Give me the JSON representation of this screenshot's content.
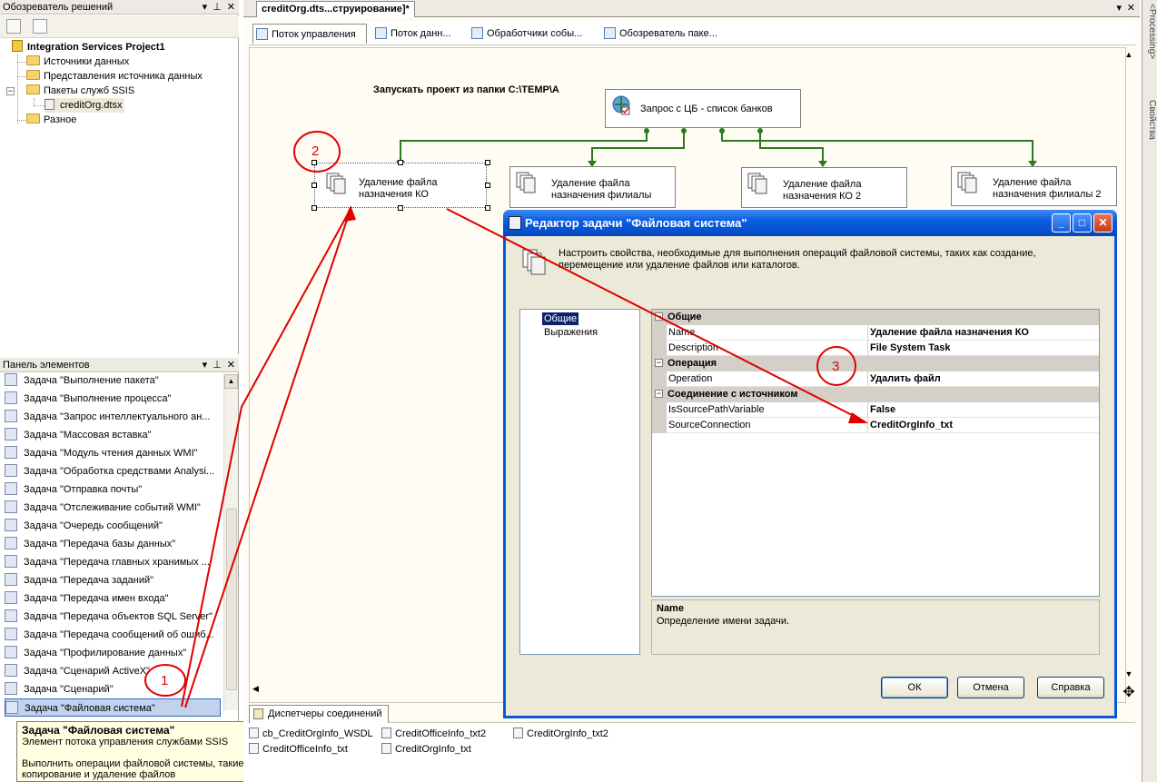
{
  "solution_explorer": {
    "title": "Обозреватель решений",
    "project": "Integration Services Project1",
    "items": [
      {
        "label": "Источники данных"
      },
      {
        "label": "Представления источника данных"
      },
      {
        "label": "Пакеты служб SSIS"
      },
      {
        "label": "creditOrg.dtsx"
      },
      {
        "label": "Разное"
      }
    ]
  },
  "toolbox": {
    "title": "Панель элементов",
    "items": [
      "Задача \"Выполнение пакета\"",
      "Задача \"Выполнение процесса\"",
      "Задача \"Запрос интеллектуального ан...",
      "Задача \"Массовая вставка\"",
      "Задача \"Модуль чтения данных WMI\"",
      "Задача \"Обработка средствами Analysi...",
      "Задача \"Отправка почты\"",
      "Задача \"Отслеживание событий WMI\"",
      "Задача \"Очередь сообщений\"",
      "Задача \"Передача базы данных\"",
      "Задача \"Передача главных хранимых ...",
      "Задача \"Передача заданий\"",
      "Задача \"Передача имен входа\"",
      "Задача \"Передача объектов SQL Server\"",
      "Задача \"Передача сообщений об ошиб...",
      "Задача \"Профилирование данных\"",
      "Задача \"Сценарий ActiveX\"",
      "Задача \"Сценарий\"",
      "Задача \"Файловая система\""
    ],
    "tooltip": {
      "title": "Задача \"Файловая система\"",
      "subtitle": "Элемент потока управления службами SSIS",
      "description": "Выполнить операции файловой системы, такие как копирование и удаление файлов"
    }
  },
  "designer": {
    "doc_tab": "creditOrg.dts...струирование]*",
    "subtabs": [
      "Поток управления",
      "Поток данн...",
      "Обработчики собы...",
      "Обозреватель паке..."
    ],
    "annotation_text": "Запускать проект из папки C:\\TEMP\\A",
    "tasks": {
      "query": "Запрос с ЦБ - список банков",
      "t1_line1": "Удаление файла",
      "t1_line2": "назначения КО",
      "t2_line1": "Удаление файла",
      "t2_line2": "назначения филиалы",
      "t3_line1": "Удаление файла",
      "t3_line2": "назначения КО 2",
      "t4_line1": "Удаление файла",
      "t4_line2": "назначения филиалы 2"
    },
    "conn_tab": "Диспетчеры соединений",
    "connections": [
      "cb_CreditOrgInfo_WSDL",
      "CreditOfficeInfo_txt2",
      "CreditOrgInfo_txt2",
      "CreditOfficeInfo_txt",
      "CreditOrgInfo_txt"
    ]
  },
  "right_dock": {
    "tab1": "<Processing>",
    "tab2": "Свойства"
  },
  "dialog": {
    "title": "Редактор задачи \"Файловая система\"",
    "description": "Настроить свойства, необходимые для выполнения операций файловой системы, таких как создание, перемещение или удаление файлов или каталогов.",
    "nav": [
      "Общие",
      "Выражения"
    ],
    "categories": {
      "general": "Общие",
      "operation": "Операция",
      "source": "Соединение с источником"
    },
    "props": {
      "name_label": "Name",
      "name_value": "Удаление файла назначения КО",
      "description_label": "Description",
      "description_value": "File System Task",
      "operation_label": "Operation",
      "operation_value": "Удалить файл",
      "issource_label": "IsSourcePathVariable",
      "issource_value": "False",
      "sourceconn_label": "SourceConnection",
      "sourceconn_value": "CreditOrgInfo_txt"
    },
    "help_title": "Name",
    "help_text": "Определение имени задачи.",
    "buttons": {
      "ok": "ОК",
      "cancel": "Отмена",
      "help": "Справка"
    }
  },
  "annotations": {
    "one": "1",
    "two": "2",
    "three": "3"
  },
  "colors": {
    "connector": "#2a7a1e",
    "annotation": "#e00000",
    "titlebar": "#0a58da"
  }
}
